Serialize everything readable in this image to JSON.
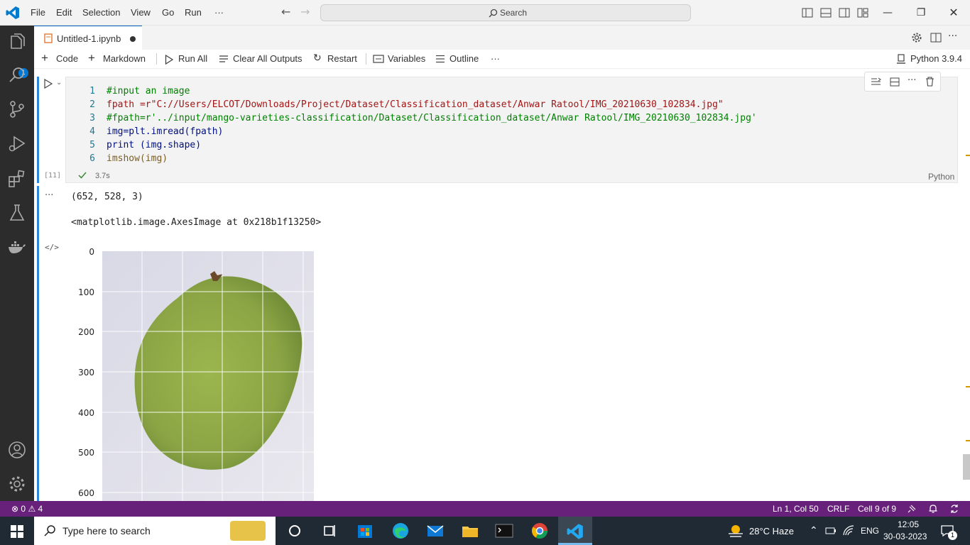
{
  "titlebar": {
    "menus": [
      "File",
      "Edit",
      "Selection",
      "View",
      "Go",
      "Run",
      "···"
    ],
    "search_label": "Search"
  },
  "activity": {
    "explorer_badge": "1"
  },
  "tab": {
    "name": "Untitled-1.ipynb"
  },
  "toolbar": {
    "code": "Code",
    "markdown": "Markdown",
    "run_all": "Run All",
    "clear_outputs": "Clear All Outputs",
    "restart": "Restart",
    "variables": "Variables",
    "outline": "Outline",
    "more": "···",
    "kernel": "Python 3.9.4"
  },
  "cell": {
    "exec_count": "[11]",
    "duration": "3.7s",
    "language": "Python",
    "line_numbers": [
      "1",
      "2",
      "3",
      "4",
      "5",
      "6"
    ],
    "lines": [
      "#input an image",
      "fpath =r\"C://Users/ELCOT/Downloads/Project/Dataset/Classification_dataset/Anwar Ratool/IMG_20210630_102834.jpg\"",
      "#fpath=r'../input/mango-varieties-classification/Dataset/Classification_dataset/Anwar Ratool/IMG_20210630_102834.jpg'",
      "img=plt.imread(fpath)",
      "print (img.shape)",
      "imshow(img)"
    ]
  },
  "output": {
    "more": "···",
    "shape": "(652, 528, 3)",
    "axes_repr": "<matplotlib.image.AxesImage at 0x218b1f13250>",
    "yticks": [
      "0",
      "100",
      "200",
      "300",
      "400",
      "500",
      "600"
    ]
  },
  "statusbar": {
    "errors": "0",
    "warnings": "4",
    "position": "Ln 1, Col 50",
    "eol": "CRLF",
    "cell_info": "Cell 9 of 9",
    "notif_count": ""
  },
  "taskbar": {
    "search_placeholder": "Type here to search",
    "weather": "28°C  Haze",
    "lang": "ENG",
    "time": "12:05",
    "date": "30-03-2023",
    "notif_badge": "1"
  },
  "colors": {
    "accent": "#2a86d8",
    "statusbar": "#68217a",
    "activitybar": "#2c2c2c"
  }
}
